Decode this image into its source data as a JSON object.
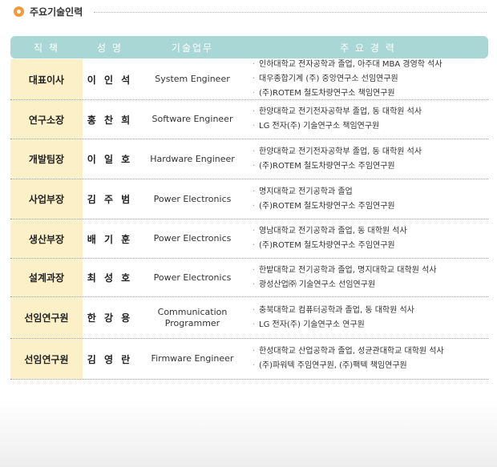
{
  "section": {
    "title": "주요기술인력"
  },
  "table": {
    "headers": {
      "position": "직 책",
      "name": "성 명",
      "duty": "기술업무",
      "career": "주 요 경 력"
    },
    "rows": [
      {
        "position": "대표이사",
        "name": "이 인 석",
        "duty": "System Engineer",
        "career": [
          "인하대학교 전자공학과 졸업, 아주대 MBA 경영학 석사",
          "대우종합기계 (주) 중앙연구소 선임연구원",
          "(주)ROTEM 철도차량연구소 책임연구원"
        ]
      },
      {
        "position": "연구소장",
        "name": "홍 찬 희",
        "duty": "Software Engineer",
        "career": [
          "한양대학교 전기전자공학부 졸업, 동 대학원 석사",
          "LG 전자(주) 기술연구소 책임연구원"
        ]
      },
      {
        "position": "개발팀장",
        "name": "이 일 호",
        "duty": "Hardware Engineer",
        "career": [
          "한양대학교 전기전자공학부 졸업, 동 대학원 석사",
          "(주)ROTEM 철도차량연구소 주임연구원"
        ]
      },
      {
        "position": "사업부장",
        "name": "김 주 범",
        "duty": "Power Electronics",
        "career": [
          "명지대학교 전기공학과 졸업",
          "(주)ROTEM 철도차량연구소 주임연구원"
        ]
      },
      {
        "position": "생산부장",
        "name": "배 기 훈",
        "duty": "Power Electronics",
        "career": [
          "영남대학교 전기공학과 졸업, 동 대학원 석사",
          "(주)ROTEM 철도차량연구소 주임연구원"
        ]
      },
      {
        "position": "설계과장",
        "name": "최 성 호",
        "duty": "Power Electronics",
        "career": [
          "한밭대학교 전기공학과 졸업, 명지대학교 대학원 석사",
          "광성산업㈜ 기술연구소 선임연구원"
        ]
      },
      {
        "position": "선임연구원",
        "name": "한 강 용",
        "duty": "Communication\nProgrammer",
        "career": [
          "충북대학교 컴퓨터공학과 졸업, 동 대학원 석사",
          "LG 전자(주) 기술연구소 연구원"
        ]
      },
      {
        "position": "선임연구원",
        "name": "김 영 란",
        "duty": "Firmware Engineer",
        "career": [
          "한성대학교 산업공학과 졸업, 성균관대학교 대학원 석사",
          "(주)파워텍 주임연구원, (주)팩텍 책임연구원"
        ]
      }
    ]
  }
}
